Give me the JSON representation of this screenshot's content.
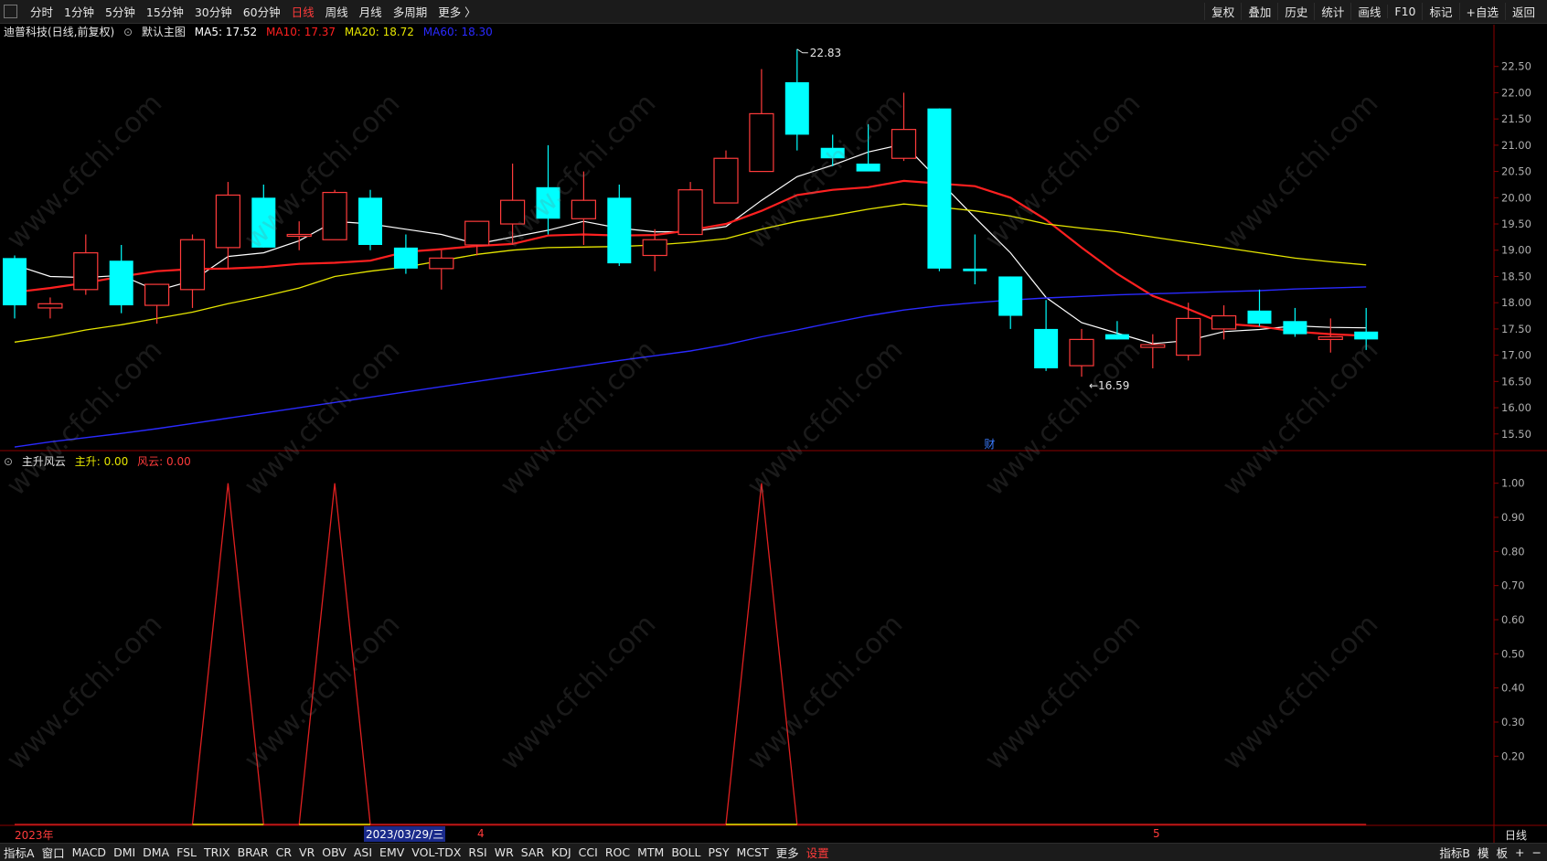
{
  "toolbar": {
    "periods": [
      "分时",
      "1分钟",
      "5分钟",
      "15分钟",
      "30分钟",
      "60分钟",
      "日线",
      "周线",
      "月线",
      "多周期",
      "更多 〉"
    ],
    "active_period": "日线",
    "right_buttons": [
      "复权",
      "叠加",
      "历史",
      "统计",
      "画线",
      "F10",
      "标记",
      "+自选",
      "返回"
    ]
  },
  "main_legend": {
    "stock": "迪普科技(日线,前复权)",
    "template": "默认主图",
    "ma5": "MA5: 17.52",
    "ma10": "MA10: 17.37",
    "ma20": "MA20: 18.72",
    "ma60": "MA60: 18.30"
  },
  "sub_legend": {
    "name": "主升风云",
    "zs": "主升: 0.00",
    "fy": "风云: 0.00"
  },
  "annotations": {
    "high_label": "22.83",
    "low_label": "←16.59",
    "fin_marker": "财"
  },
  "xaxis": {
    "year_label": "2023年",
    "cursor_date": "2023/03/29/三",
    "month_4": "4",
    "month_5": "5",
    "period_label": "日线"
  },
  "bottom_tabs": [
    "指标A",
    "窗口",
    "MACD",
    "DMI",
    "DMA",
    "FSL",
    "TRIX",
    "BRAR",
    "CR",
    "VR",
    "OBV",
    "ASI",
    "EMV",
    "VOL-TDX",
    "RSI",
    "WR",
    "SAR",
    "KDJ",
    "CCI",
    "ROC",
    "MTM",
    "BOLL",
    "PSY",
    "MCST",
    "更多",
    "设置"
  ],
  "bottom_right": [
    "指标B",
    "模",
    "板",
    "+",
    "−"
  ],
  "watermark": "www.cfchi.com",
  "colors": {
    "up": "#ff3b3b",
    "down": "#00ffff",
    "ma5": "#ffffff",
    "ma10": "#ff2020",
    "ma20": "#e6e600",
    "ma60": "#2a2aff",
    "axis": "#8b0000",
    "indicator": "#e02020",
    "indicator_base": "#e6e600"
  },
  "chart_data": [
    {
      "type": "candlestick",
      "title": "迪普科技(日线,前复权)",
      "ylim": [
        15.2,
        23.0
      ],
      "yticks": [
        15.5,
        16.0,
        16.5,
        17.0,
        17.5,
        18.0,
        18.5,
        19.0,
        19.5,
        20.0,
        20.5,
        21.0,
        21.5,
        22.0,
        22.5
      ],
      "candles": [
        {
          "o": 18.85,
          "h": 18.9,
          "l": 17.7,
          "c": 17.95
        },
        {
          "o": 17.9,
          "h": 18.1,
          "l": 17.7,
          "c": 17.98
        },
        {
          "o": 18.25,
          "h": 19.3,
          "l": 18.15,
          "c": 18.95
        },
        {
          "o": 18.8,
          "h": 19.1,
          "l": 17.8,
          "c": 17.95
        },
        {
          "o": 17.95,
          "h": 18.35,
          "l": 17.6,
          "c": 18.35
        },
        {
          "o": 18.25,
          "h": 19.3,
          "l": 17.9,
          "c": 19.2
        },
        {
          "o": 19.05,
          "h": 20.3,
          "l": 18.65,
          "c": 20.05
        },
        {
          "o": 20.0,
          "h": 20.25,
          "l": 19.05,
          "c": 19.05
        },
        {
          "o": 19.3,
          "h": 19.55,
          "l": 19.0,
          "c": 19.3
        },
        {
          "o": 19.2,
          "h": 20.15,
          "l": 19.2,
          "c": 20.1
        },
        {
          "o": 20.0,
          "h": 20.15,
          "l": 19.0,
          "c": 19.1
        },
        {
          "o": 19.05,
          "h": 19.3,
          "l": 18.55,
          "c": 18.65
        },
        {
          "o": 18.65,
          "h": 19.0,
          "l": 18.25,
          "c": 18.85
        },
        {
          "o": 19.1,
          "h": 19.55,
          "l": 18.9,
          "c": 19.55
        },
        {
          "o": 19.5,
          "h": 20.65,
          "l": 19.1,
          "c": 19.95
        },
        {
          "o": 20.2,
          "h": 21.0,
          "l": 19.3,
          "c": 19.6
        },
        {
          "o": 19.6,
          "h": 20.5,
          "l": 19.1,
          "c": 19.95
        },
        {
          "o": 20.0,
          "h": 20.25,
          "l": 18.7,
          "c": 18.75
        },
        {
          "o": 18.9,
          "h": 19.4,
          "l": 18.6,
          "c": 19.2
        },
        {
          "o": 19.3,
          "h": 20.3,
          "l": 19.3,
          "c": 20.15
        },
        {
          "o": 19.9,
          "h": 20.9,
          "l": 19.9,
          "c": 20.75
        },
        {
          "o": 20.5,
          "h": 22.45,
          "l": 20.5,
          "c": 21.6
        },
        {
          "o": 22.2,
          "h": 22.83,
          "l": 20.9,
          "c": 21.2
        },
        {
          "o": 20.95,
          "h": 21.2,
          "l": 20.6,
          "c": 20.75
        },
        {
          "o": 20.65,
          "h": 21.4,
          "l": 20.55,
          "c": 20.5
        },
        {
          "o": 20.75,
          "h": 22.0,
          "l": 20.7,
          "c": 21.3
        },
        {
          "o": 21.7,
          "h": 21.7,
          "l": 18.6,
          "c": 18.65
        },
        {
          "o": 18.65,
          "h": 19.3,
          "l": 18.35,
          "c": 18.6
        },
        {
          "o": 18.5,
          "h": 18.5,
          "l": 17.5,
          "c": 17.75
        },
        {
          "o": 17.5,
          "h": 18.05,
          "l": 16.7,
          "c": 16.75
        },
        {
          "o": 16.8,
          "h": 17.5,
          "l": 16.59,
          "c": 17.3
        },
        {
          "o": 17.4,
          "h": 17.65,
          "l": 17.3,
          "c": 17.3
        },
        {
          "o": 17.15,
          "h": 17.4,
          "l": 16.75,
          "c": 17.2
        },
        {
          "o": 17.0,
          "h": 18.0,
          "l": 16.9,
          "c": 17.7
        },
        {
          "o": 17.5,
          "h": 17.95,
          "l": 17.3,
          "c": 17.75
        },
        {
          "o": 17.85,
          "h": 18.25,
          "l": 17.55,
          "c": 17.6
        },
        {
          "o": 17.65,
          "h": 17.9,
          "l": 17.35,
          "c": 17.4
        },
        {
          "o": 17.3,
          "h": 17.7,
          "l": 17.05,
          "c": 17.35
        },
        {
          "o": 17.45,
          "h": 17.9,
          "l": 17.1,
          "c": 17.3
        }
      ],
      "series": [
        {
          "name": "MA5",
          "values": [
            18.72,
            18.5,
            18.48,
            18.52,
            18.23,
            18.42,
            18.88,
            18.95,
            19.18,
            19.55,
            19.5,
            19.4,
            19.3,
            19.12,
            19.25,
            19.38,
            19.55,
            19.42,
            19.35,
            19.35,
            19.45,
            19.95,
            20.4,
            20.62,
            20.87,
            21.02,
            20.32,
            19.62,
            18.95,
            18.1,
            17.62,
            17.42,
            17.22,
            17.28,
            17.45,
            17.49,
            17.56,
            17.53,
            17.52
          ]
        },
        {
          "name": "MA10",
          "values": [
            18.2,
            18.28,
            18.38,
            18.5,
            18.6,
            18.64,
            18.65,
            18.68,
            18.74,
            18.76,
            18.8,
            18.97,
            19.02,
            19.08,
            19.12,
            19.28,
            19.3,
            19.28,
            19.29,
            19.38,
            19.5,
            19.75,
            20.05,
            20.15,
            20.2,
            20.32,
            20.27,
            20.22,
            20.0,
            19.58,
            19.05,
            18.55,
            18.13,
            17.88,
            17.6,
            17.55,
            17.45,
            17.4,
            17.37
          ]
        },
        {
          "name": "MA20",
          "values": [
            17.25,
            17.35,
            17.48,
            17.58,
            17.7,
            17.82,
            17.98,
            18.12,
            18.28,
            18.5,
            18.6,
            18.68,
            18.8,
            18.92,
            19.0,
            19.05,
            19.06,
            19.07,
            19.1,
            19.15,
            19.22,
            19.4,
            19.55,
            19.66,
            19.78,
            19.88,
            19.82,
            19.75,
            19.65,
            19.5,
            19.42,
            19.35,
            19.25,
            19.15,
            19.05,
            18.95,
            18.85,
            18.78,
            18.72
          ]
        },
        {
          "name": "MA60",
          "values": [
            15.25,
            15.35,
            15.43,
            15.51,
            15.6,
            15.7,
            15.8,
            15.9,
            16.0,
            16.1,
            16.2,
            16.3,
            16.4,
            16.5,
            16.6,
            16.7,
            16.8,
            16.9,
            16.99,
            17.08,
            17.2,
            17.35,
            17.48,
            17.62,
            17.75,
            17.86,
            17.94,
            18.0,
            18.05,
            18.09,
            18.12,
            18.15,
            18.17,
            18.19,
            18.21,
            18.23,
            18.26,
            18.28,
            18.3
          ]
        }
      ]
    },
    {
      "type": "line",
      "title": "主升风云",
      "ylim": [
        0.0,
        1.05
      ],
      "yticks": [
        0.2,
        0.3,
        0.4,
        0.5,
        0.6,
        0.7,
        0.8,
        0.9,
        1.0
      ],
      "peaks": [
        6,
        9,
        21
      ],
      "series": [
        {
          "name": "主升",
          "values": [
            0,
            0,
            0,
            0,
            0,
            0,
            1,
            0,
            0,
            1,
            0,
            0,
            0,
            0,
            0,
            0,
            0,
            0,
            0,
            0,
            0,
            1,
            0,
            0,
            0,
            0,
            0,
            0,
            0,
            0,
            0,
            0,
            0,
            0,
            0,
            0,
            0,
            0,
            0
          ]
        },
        {
          "name": "风云",
          "values": [
            0,
            0,
            0,
            0,
            0,
            0,
            0,
            0,
            0,
            0,
            0,
            0,
            0,
            0,
            0,
            0,
            0,
            0,
            0,
            0,
            0,
            0,
            0,
            0,
            0,
            0,
            0,
            0,
            0,
            0,
            0,
            0,
            0,
            0,
            0,
            0,
            0,
            0,
            0
          ]
        }
      ]
    }
  ]
}
